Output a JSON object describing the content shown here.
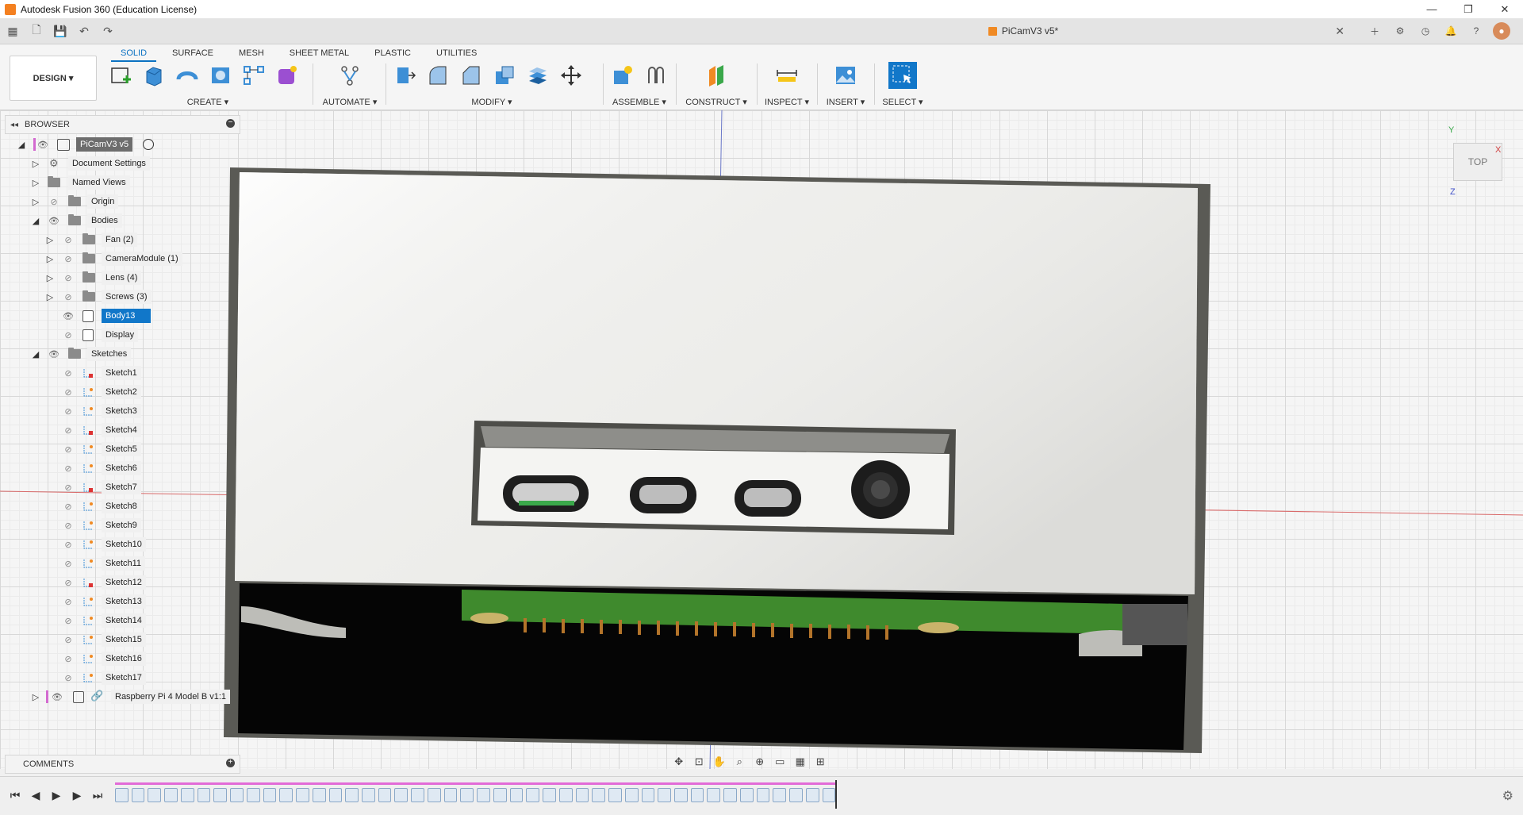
{
  "app": {
    "window_title": "Autodesk Fusion 360 (Education License)",
    "document_tab": "PiCamV3 v5*"
  },
  "ribbon": {
    "workspace": "DESIGN",
    "tabs": [
      "SOLID",
      "SURFACE",
      "MESH",
      "SHEET METAL",
      "PLASTIC",
      "UTILITIES"
    ],
    "active_tab": "SOLID",
    "groups": [
      "CREATE",
      "AUTOMATE",
      "MODIFY",
      "ASSEMBLE",
      "CONSTRUCT",
      "INSPECT",
      "INSERT",
      "SELECT"
    ]
  },
  "browser": {
    "title": "BROWSER",
    "root": "PiCamV3 v5",
    "items": [
      {
        "label": "Document Settings"
      },
      {
        "label": "Named Views"
      },
      {
        "label": "Origin"
      },
      {
        "label": "Bodies"
      },
      {
        "label": "Fan (2)"
      },
      {
        "label": "CameraModule (1)"
      },
      {
        "label": "Lens (4)"
      },
      {
        "label": "Screws (3)"
      },
      {
        "label": "Body13"
      },
      {
        "label": "Display"
      },
      {
        "label": "Sketches"
      }
    ],
    "sketches": [
      "Sketch1",
      "Sketch2",
      "Sketch3",
      "Sketch4",
      "Sketch5",
      "Sketch6",
      "Sketch7",
      "Sketch8",
      "Sketch9",
      "Sketch10",
      "Sketch11",
      "Sketch12",
      "Sketch13",
      "Sketch14",
      "Sketch15",
      "Sketch16",
      "Sketch17"
    ],
    "linked_component": "Raspberry Pi 4 Model B v1:1"
  },
  "comments": {
    "title": "COMMENTS"
  },
  "viewcube": {
    "face": "TOP",
    "axis_x": "X",
    "axis_y": "Y",
    "axis_z": "Z"
  },
  "colors": {
    "accent": "#1177c9",
    "pcb": "#3f8a2d",
    "timeline_track": "#e26bd7"
  }
}
